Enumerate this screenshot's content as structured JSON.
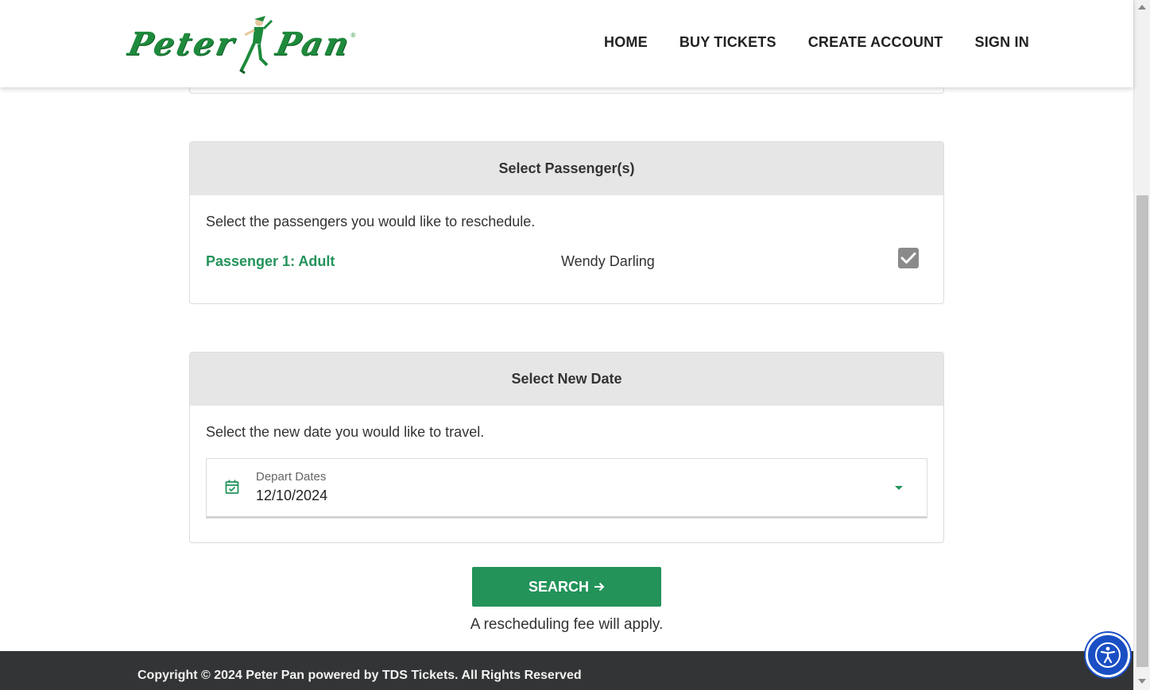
{
  "header": {
    "logo_text_left": "Peter",
    "logo_text_right": "Pan",
    "logo_reg_mark": "®",
    "nav": [
      {
        "label": "HOME"
      },
      {
        "label": "BUY TICKETS"
      },
      {
        "label": "CREATE ACCOUNT"
      },
      {
        "label": "SIGN IN"
      }
    ]
  },
  "passengers_card": {
    "title": "Select Passenger(s)",
    "description": "Select the passengers you would like to reschedule.",
    "passengers": [
      {
        "label": "Passenger 1: Adult",
        "name": "Wendy Darling",
        "checked": true
      }
    ]
  },
  "date_card": {
    "title": "Select New Date",
    "description": "Select the new date you would like to travel.",
    "depart_field": {
      "label": "Depart Dates",
      "value": "12/10/2024",
      "icon": "calendar-check-icon"
    }
  },
  "actions": {
    "search_label": "SEARCH",
    "search_icon": "arrow-right-icon",
    "fee_note": "A rescheduling fee will apply."
  },
  "footer": {
    "copyright": "Copyright © 2024 Peter Pan powered by TDS Tickets. All Rights Reserved"
  },
  "colors": {
    "brand_green": "#23935a",
    "logo_green": "#1e8a3c",
    "footer_bg": "#333435",
    "accessibility_blue": "#1a4fc4"
  },
  "accessibility_button": {
    "icon": "accessibility-icon"
  }
}
